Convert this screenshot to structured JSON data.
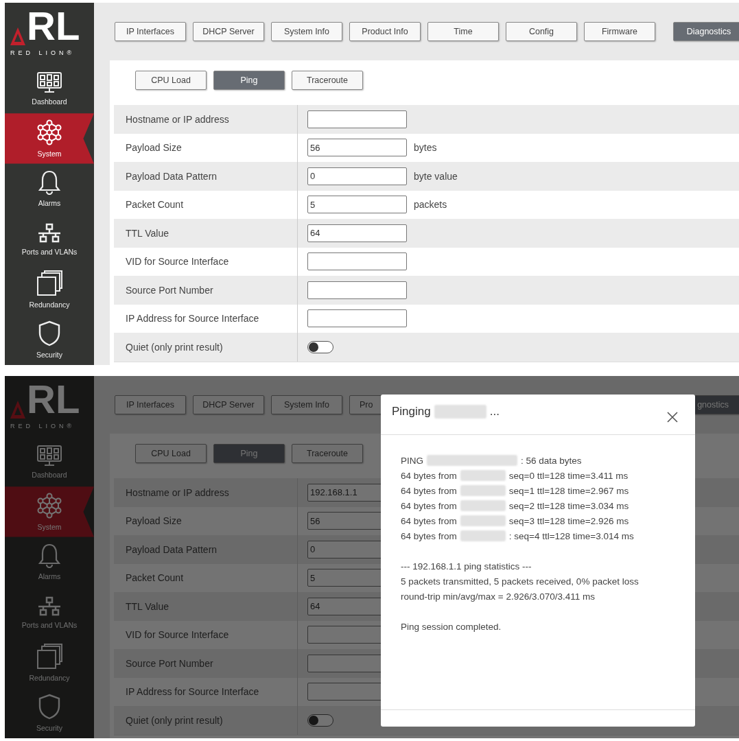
{
  "screens": [
    {
      "logo": {
        "mark": "RL",
        "wordmark": "RED LION®"
      },
      "sidebar": {
        "items": [
          {
            "label": "Dashboard",
            "selected": false
          },
          {
            "label": "System",
            "selected": true
          },
          {
            "label": "Alarms",
            "selected": false
          },
          {
            "label": "Ports and VLANs",
            "selected": false
          },
          {
            "label": "Redundancy",
            "selected": false
          },
          {
            "label": "Security",
            "selected": false
          }
        ]
      },
      "tabs": [
        {
          "label": "IP Interfaces",
          "selected": false
        },
        {
          "label": "DHCP Server",
          "selected": false
        },
        {
          "label": "System Info",
          "selected": false
        },
        {
          "label": "Product Info",
          "selected": false
        },
        {
          "label": "Time",
          "selected": false
        },
        {
          "label": "Config",
          "selected": false
        },
        {
          "label": "Firmware",
          "selected": false
        },
        {
          "label": "Diagnostics",
          "selected": true
        }
      ],
      "subtabs": [
        {
          "label": "CPU Load",
          "selected": false
        },
        {
          "label": "Ping",
          "selected": true
        },
        {
          "label": "Traceroute",
          "selected": false
        }
      ],
      "fields": [
        {
          "label": "Hostname or IP address",
          "kind": "input"
        },
        {
          "label": "Payload Size",
          "kind": "input",
          "value": "56",
          "unit": "bytes"
        },
        {
          "label": "Payload Data Pattern",
          "kind": "input",
          "value": "0",
          "unit": "byte value"
        },
        {
          "label": "Packet Count",
          "kind": "input",
          "value": "5",
          "unit": "packets"
        },
        {
          "label": "TTL Value",
          "kind": "input",
          "value": "64"
        },
        {
          "label": "VID for Source Interface",
          "kind": "input"
        },
        {
          "label": "Source Port Number",
          "kind": "input"
        },
        {
          "label": "IP Address for Source Interface",
          "kind": "input"
        },
        {
          "label": "Quiet (only print result)",
          "kind": "toggle",
          "on": false
        }
      ]
    },
    {
      "logo": {
        "mark": "RL",
        "wordmark": "RED LION®"
      },
      "sidebar": {
        "items": [
          {
            "label": "Dashboard",
            "selected": false
          },
          {
            "label": "System",
            "selected": true
          },
          {
            "label": "Alarms",
            "selected": false
          },
          {
            "label": "Ports and VLANs",
            "selected": false
          },
          {
            "label": "Redundancy",
            "selected": false
          },
          {
            "label": "Security",
            "selected": false
          }
        ]
      },
      "tabs": [
        {
          "label": "IP Interfaces",
          "selected": false
        },
        {
          "label": "DHCP Server",
          "selected": false
        },
        {
          "label": "System Info",
          "selected": false
        },
        {
          "label": "Pro",
          "selected": false,
          "kind": "clipped"
        },
        {
          "label": "gnostics",
          "selected": true,
          "kind": "clipped"
        }
      ],
      "subtabs": [
        {
          "label": "CPU Load",
          "selected": false
        },
        {
          "label": "Ping",
          "selected": true
        },
        {
          "label": "Traceroute",
          "selected": false
        }
      ],
      "fields": [
        {
          "label": "Hostname or IP address",
          "kind": "input",
          "value": "192.168.1.1"
        },
        {
          "label": "Payload Size",
          "kind": "input",
          "value": "56"
        },
        {
          "label": "Payload Data Pattern",
          "kind": "input",
          "value": "0"
        },
        {
          "label": "Packet Count",
          "kind": "input",
          "value": "5"
        },
        {
          "label": "TTL Value",
          "kind": "input",
          "value": "64"
        },
        {
          "label": "VID for Source Interface",
          "kind": "input"
        },
        {
          "label": "Source Port Number",
          "kind": "input"
        },
        {
          "label": "IP Address for Source Interface",
          "kind": "input"
        },
        {
          "label": "Quiet (only print result)",
          "kind": "toggle",
          "on": false
        }
      ],
      "dialog": {
        "title": [
          {
            "text": "Pinging"
          },
          {
            "kind": "redacted"
          },
          {
            "text": "..."
          }
        ],
        "paragraphs": [
          [
            [
              {
                "text": "PING"
              },
              {
                "kind": "redacted"
              },
              {
                "text": ": 56 data bytes"
              }
            ],
            [
              {
                "text": "64 bytes from"
              },
              {
                "kind": "redacted"
              },
              {
                "text": "seq=0 ttl=128 time=3.411 ms"
              }
            ],
            [
              {
                "text": "64 bytes from"
              },
              {
                "kind": "redacted"
              },
              {
                "text": "seq=1 ttl=128 time=2.967 ms"
              }
            ],
            [
              {
                "text": "64 bytes from"
              },
              {
                "kind": "redacted"
              },
              {
                "text": "seq=2 ttl=128 time=3.034 ms"
              }
            ],
            [
              {
                "text": "64 bytes from"
              },
              {
                "kind": "redacted"
              },
              {
                "text": "seq=3 ttl=128 time=2.926 ms"
              }
            ],
            [
              {
                "text": "64 bytes from"
              },
              {
                "kind": "redacted"
              },
              {
                "text": ": seq=4 ttl=128 time=3.014 ms"
              }
            ]
          ],
          [
            [
              {
                "text": "--- 192.168.1.1 ping statistics ---"
              }
            ],
            [
              {
                "text": "5 packets transmitted, 5 packets received, 0% packet loss"
              }
            ],
            [
              {
                "text": "round-trip min/avg/max = 2.926/3.070/3.411 ms"
              }
            ]
          ],
          [
            [
              {
                "text": "Ping session completed."
              }
            ]
          ]
        ]
      }
    }
  ]
}
